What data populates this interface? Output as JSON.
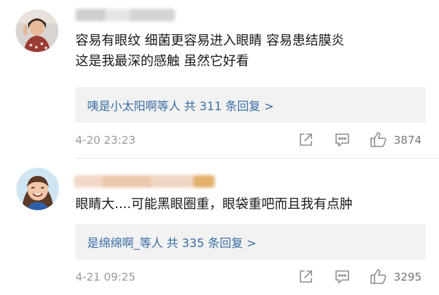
{
  "comments": [
    {
      "text_line1": "容易有眼纹 细菌更容易进入眼睛 容易患结膜炎",
      "text_line2": "这是我最深的感触 虽然它好看",
      "reply_names": "咦是小太阳啊等人",
      "reply_count": "共 311 条回复 >",
      "time": "4-20 23:23",
      "likes": "3874"
    },
    {
      "text_line1": "眼睛大....可能黑眼圈重，眼袋重吧而且我有点肿",
      "reply_names": "是绵绵啊_等人",
      "reply_count": "共 335 条回复 >",
      "time": "4-21 09:25",
      "likes": "3295"
    }
  ],
  "colors": {
    "link": "#3b6ea5",
    "meta": "#9a9a9a",
    "reply_bg": "#f2f2f2"
  },
  "icons": [
    "share-icon",
    "comment-icon",
    "thumbs-up-icon"
  ]
}
